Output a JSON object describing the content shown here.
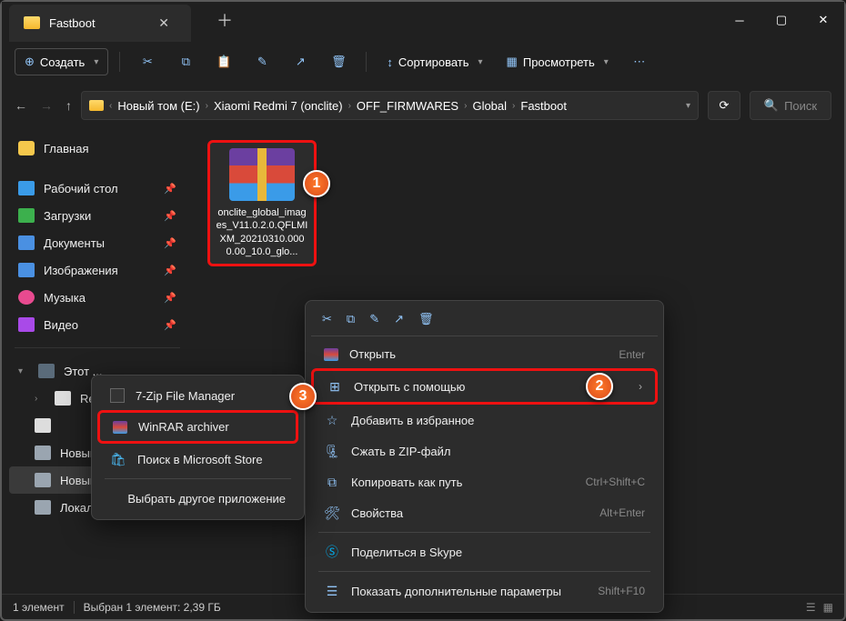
{
  "titlebar": {
    "tab_title": "Fastboot"
  },
  "toolbar": {
    "new_label": "Создать",
    "sort_label": "Сортировать",
    "view_label": "Просмотреть"
  },
  "breadcrumb": {
    "items": [
      "Новый том (E:)",
      "Xiaomi Redmi 7 (onclite)",
      "OFF_FIRMWARES",
      "Global",
      "Fastboot"
    ]
  },
  "search": {
    "placeholder": "Поиск"
  },
  "sidebar": {
    "home": "Главная",
    "desktop": "Рабочий стол",
    "downloads": "Загрузки",
    "documents": "Документы",
    "pictures": "Изображения",
    "music": "Музыка",
    "video": "Видео",
    "this_pc": "Этот ...",
    "re": "Re",
    "drive_d": "Новый том (D:)",
    "drive_e": "Новый том (E:)",
    "drive_f": "Локальный диск (F:)"
  },
  "file": {
    "name": "onclite_global_images_V11.0.2.0.QFLMIXM_20210310.0000.00_10.0_glo..."
  },
  "context_main": {
    "open": "Открыть",
    "open_with": "Открыть с помощью",
    "favorites": "Добавить в избранное",
    "zip": "Сжать в ZIP-файл",
    "copy_path": "Копировать как путь",
    "properties": "Свойства",
    "skype": "Поделиться в Skype",
    "more": "Показать дополнительные параметры",
    "sc_open": "Enter",
    "sc_copy": "Ctrl+Shift+C",
    "sc_props": "Alt+Enter",
    "sc_more": "Shift+F10"
  },
  "context_sub": {
    "sevenzip": "7-Zip File Manager",
    "winrar": "WinRAR archiver",
    "store": "Поиск в Microsoft Store",
    "other": "Выбрать другое приложение"
  },
  "status": {
    "count": "1 элемент",
    "selection": "Выбран 1 элемент: 2,39 ГБ"
  },
  "callouts": {
    "c1": "1",
    "c2": "2",
    "c3": "3"
  }
}
